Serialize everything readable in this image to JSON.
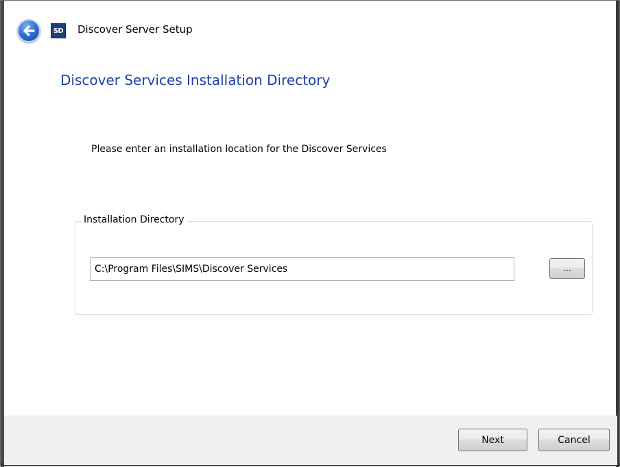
{
  "window": {
    "title": "Discover Server Setup",
    "app_icon_text": "SD",
    "back_icon": "back-arrow-icon"
  },
  "page": {
    "heading": "Discover Services Installation Directory",
    "instruction": "Please enter an installation location for the Discover Services"
  },
  "install_group": {
    "legend": "Installation Directory",
    "directory_value": "C:\\Program Files\\SIMS\\Discover Services",
    "browse_label": "..."
  },
  "footer": {
    "next_label": "Next",
    "cancel_label": "Cancel"
  },
  "colors": {
    "heading": "#1e3fa8",
    "footer_background": "#f0f0f0",
    "back_button": "#2e6fd0"
  }
}
